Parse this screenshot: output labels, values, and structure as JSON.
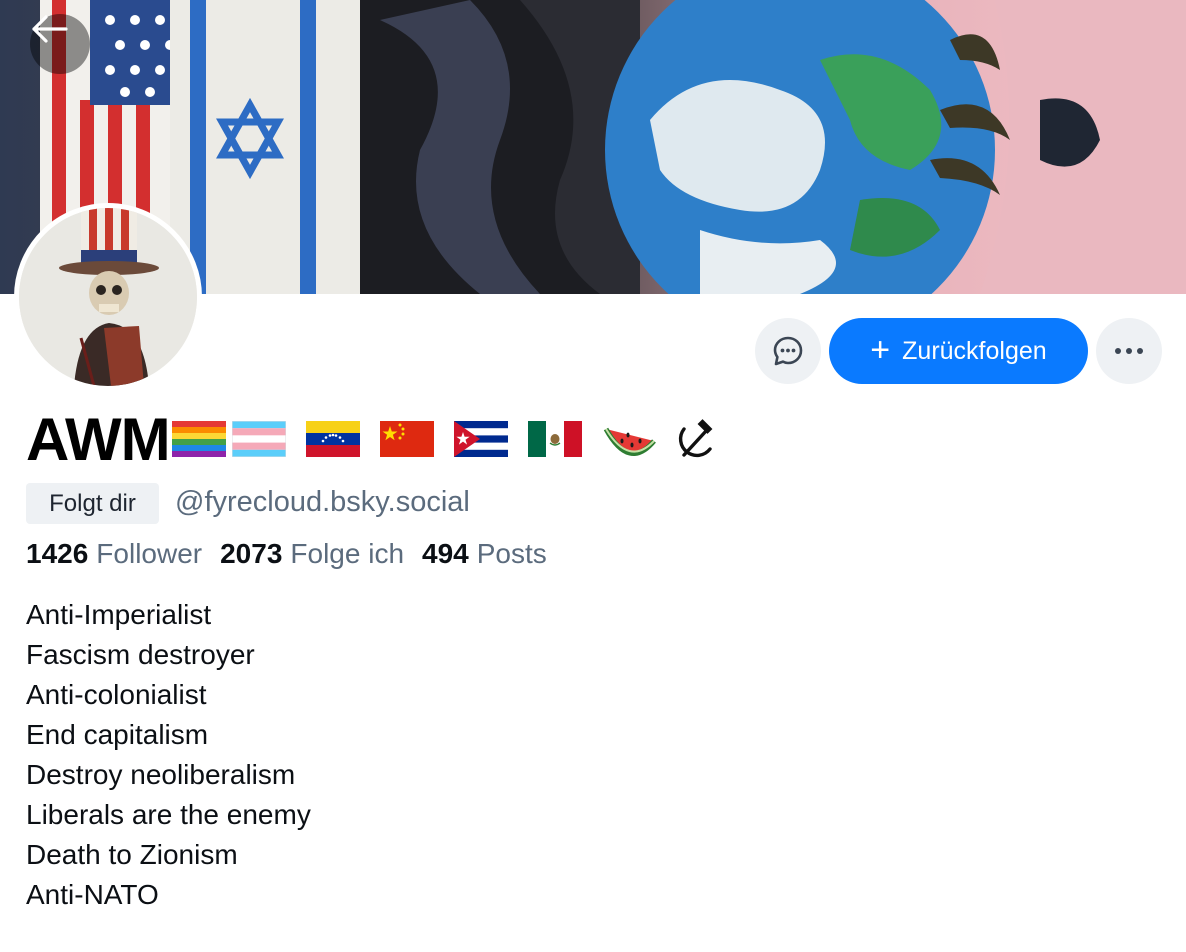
{
  "profile": {
    "display_name": "AWM",
    "name_emojis": [
      "rainbow-flag",
      "trans-flag",
      "venezuela-flag",
      "china-flag",
      "cuba-flag",
      "mexico-flag",
      "watermelon",
      "hammer-and-sickle"
    ],
    "follows_you_badge": "Folgt dir",
    "handle": "@fyrecloud.bsky.social",
    "stats": {
      "followers_count": "1426",
      "followers_label": "Follower",
      "following_count": "2073",
      "following_label": "Folge ich",
      "posts_count": "494",
      "posts_label": "Posts"
    },
    "bio_lines": [
      "Anti-Imperialist",
      "Fascism destroyer",
      "Anti-colonialist",
      "End capitalism",
      "Destroy neoliberalism",
      "Liberals are the enemy",
      "Death to Zionism",
      "Anti-NATO"
    ]
  },
  "actions": {
    "message_icon": "chat-bubble-icon",
    "follow_back_label": "Zurückfolgen",
    "follow_back_icon": "plus-icon",
    "more_icon": "ellipsis-icon",
    "back_icon": "arrow-left-icon"
  },
  "colors": {
    "accent": "#0a7aff",
    "muted_text": "#5b6b7d",
    "button_bg": "#eef1f4"
  }
}
